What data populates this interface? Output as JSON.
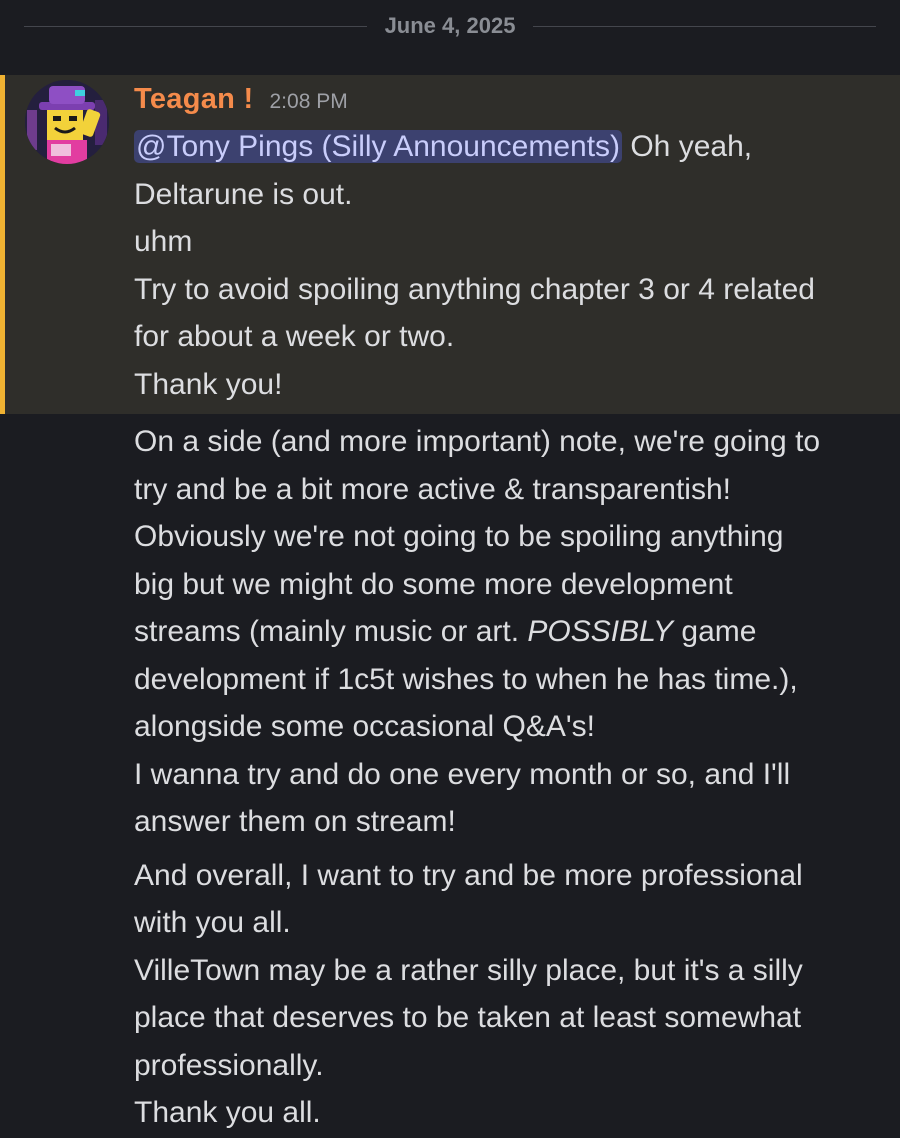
{
  "divider": {
    "date": "June 4, 2025"
  },
  "message": {
    "author": "Teagan !",
    "timestamp": "2:08 PM",
    "avatar_icon": "roblox-avatar-icon",
    "colors": {
      "author": "#f58b4b",
      "highlight_bar": "#f0b232",
      "mention_bg": "#3c416f"
    },
    "mention": "@Tony Pings (Silly Announcements)",
    "first_line_rest": " Oh yeah,",
    "lines_highlight": [
      "Deltarune is out.",
      "uhm",
      "Try to avoid spoiling anything chapter 3 or 4 related",
      "for about a week or two.",
      "Thank you!"
    ],
    "paragraph1": {
      "lines": [
        "On a side (and more important) note, we're going to",
        "try and be a bit more active & transparentish!",
        "Obviously we're not going to be spoiling anything",
        "big but we might do some more development"
      ],
      "line5_pre": "streams (mainly music or art. ",
      "line5_em": "POSSIBLY",
      "line5_post": " game",
      "lines_after": [
        "development if 1c5t wishes to when he has time.),",
        "alongside some occasional Q&A's!",
        "I wanna try and do one every month or so, and I'll",
        "answer them on stream!"
      ]
    },
    "paragraph2": {
      "lines": [
        "And overall, I want to try and be more professional",
        "with you all.",
        "VilleTown may be a rather silly place, but it's a silly",
        "place that deserves to be taken at least somewhat",
        "professionally.",
        "Thank you all."
      ]
    }
  }
}
